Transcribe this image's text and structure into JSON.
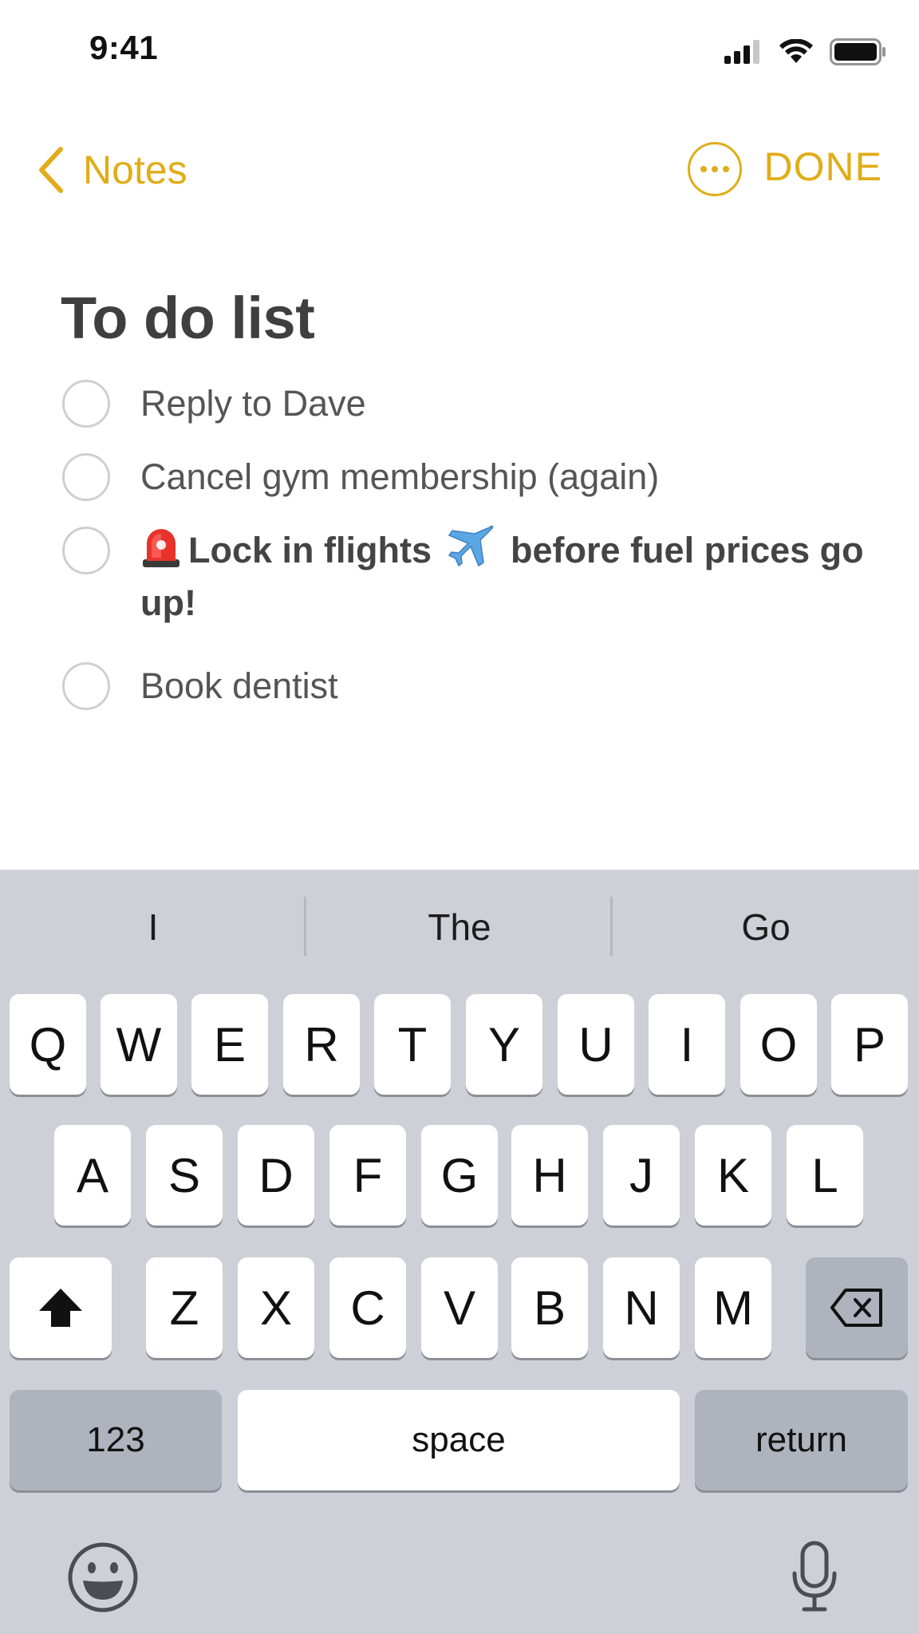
{
  "status_bar": {
    "time": "9:41",
    "icons": [
      "cellular-signal-icon",
      "wifi-icon",
      "battery-icon"
    ]
  },
  "nav": {
    "back_label": "Notes",
    "more_icon": "ellipsis-circle-icon",
    "done_label": "DONE"
  },
  "note": {
    "title": "To do list",
    "items": [
      {
        "text": "Reply to Dave",
        "checked": false,
        "bold": false
      },
      {
        "text": "Cancel gym membership (again)",
        "checked": false,
        "bold": false
      },
      {
        "text_before": "Lock in flights",
        "text_after": "before fuel prices go up!",
        "emoji_1": "police-light-icon",
        "emoji_2": "airplane-icon",
        "checked": false,
        "bold": true
      },
      {
        "text": "Book dentist",
        "checked": false,
        "bold": false
      }
    ]
  },
  "keyboard": {
    "predictions": [
      "I",
      "The",
      "Go"
    ],
    "row1": [
      "Q",
      "W",
      "E",
      "R",
      "T",
      "Y",
      "U",
      "I",
      "O",
      "P"
    ],
    "row2": [
      "A",
      "S",
      "D",
      "F",
      "G",
      "H",
      "J",
      "K",
      "L"
    ],
    "row3": [
      "Z",
      "X",
      "C",
      "V",
      "B",
      "N",
      "M"
    ],
    "shift_icon": "shift-arrow-icon",
    "delete_icon": "delete-backspace-icon",
    "numbers_label": "123",
    "space_label": "space",
    "return_label": "return",
    "emoji_icon": "emoji-face-icon",
    "mic_icon": "microphone-icon"
  },
  "colors": {
    "accent": "#e0ad18",
    "keyboard_bg": "#cdd0d6",
    "key_bg": "#ffffff",
    "key_dark_bg": "#aeb3bd"
  }
}
